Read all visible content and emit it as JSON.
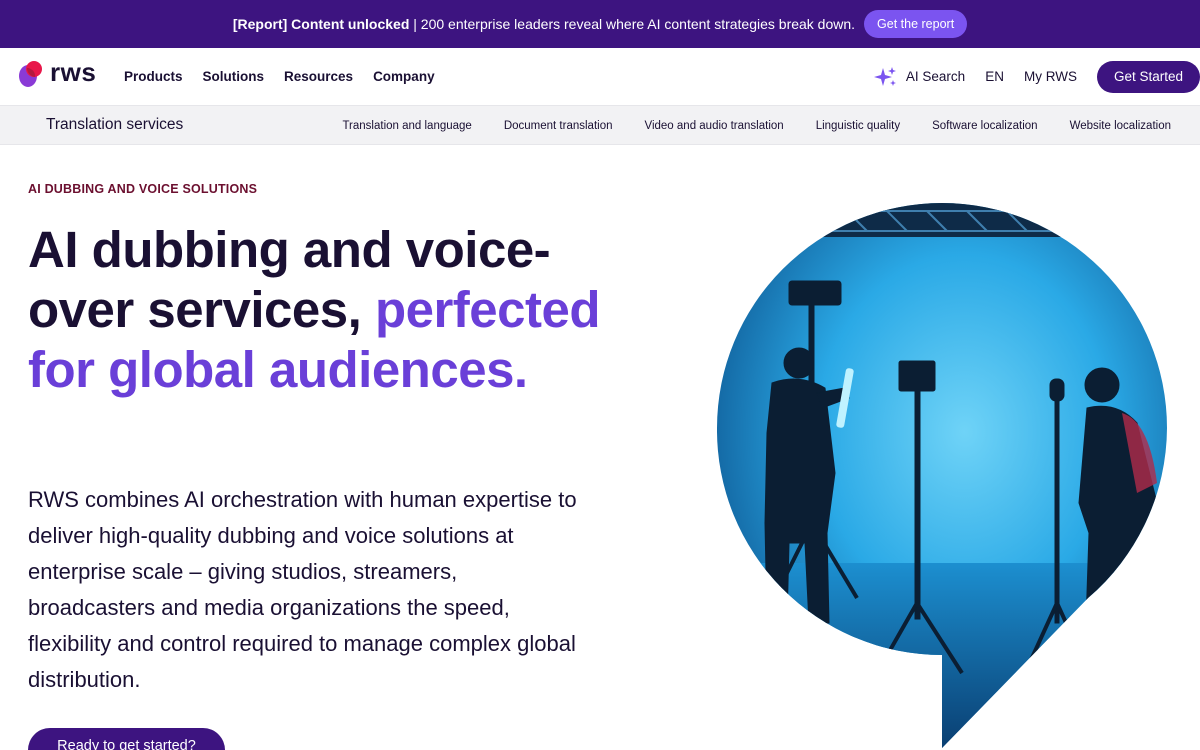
{
  "promo": {
    "strong": "[Report] Content unlocked",
    "text": "| 200 enterprise leaders reveal where AI content strategies break down.",
    "cta": "Get the report"
  },
  "logo": {
    "text": "rws"
  },
  "nav": {
    "items": [
      "Products",
      "Solutions",
      "Resources",
      "Company"
    ],
    "ai_search": "AI Search",
    "lang": "EN",
    "my_rws": "My RWS",
    "get_started": "Get Started"
  },
  "subnav": {
    "title": "Translation services",
    "items": [
      "Translation and language",
      "Document translation",
      "Video and audio translation",
      "Linguistic quality",
      "Software localization",
      "Website localization"
    ]
  },
  "hero": {
    "eyebrow": "AI DUBBING AND VOICE SOLUTIONS",
    "headline_part1": "AI dubbing and voice-over services,",
    "headline_part2": "perfected for global audiences.",
    "description": "RWS combines AI orchestration with human expertise to deliver high-quality dubbing and voice solutions at enterprise scale – giving studios, streamers, broadcasters and media organizations the speed, flexibility and control required to manage complex global distribution.",
    "cta": "Ready to get started?"
  },
  "colors": {
    "brand_dark": "#3d1480",
    "accent_purple": "#6a3fd8",
    "promo_button": "#7b54f0",
    "eyebrow": "#6b0f2f"
  },
  "icons": [
    "rws-logo-icon",
    "sparkle-icon"
  ]
}
